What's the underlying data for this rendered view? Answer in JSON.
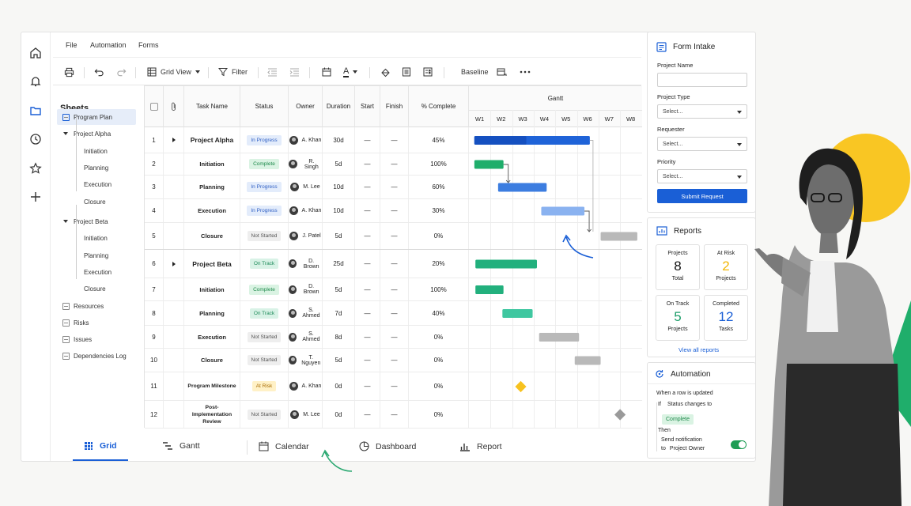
{
  "menu": [
    "File",
    "Automation",
    "Forms"
  ],
  "toolbar": {
    "grid_view": "Grid View",
    "filter": "Filter",
    "font_color_letter": "A",
    "baseline": "Baseline"
  },
  "sheets": {
    "title": "Sheets",
    "items": [
      {
        "label": "Program Plan",
        "level": 0,
        "active": true
      },
      {
        "label": "Project Alpha",
        "level": 1,
        "expanded": true
      },
      {
        "label": "Initiation",
        "level": 2
      },
      {
        "label": "Planning",
        "level": 2
      },
      {
        "label": "Execution",
        "level": 2
      },
      {
        "label": "Closure",
        "level": 2
      },
      {
        "label": "Project Beta",
        "level": 1,
        "expanded": true
      },
      {
        "label": "Initiation",
        "level": 2
      },
      {
        "label": "Planning",
        "level": 2
      },
      {
        "label": "Execution",
        "level": 2
      },
      {
        "label": "Closure",
        "level": 2
      },
      {
        "label": "Resources",
        "level": 0
      },
      {
        "label": "Risks",
        "level": 0
      },
      {
        "label": "Issues",
        "level": 0
      },
      {
        "label": "Dependencies Log",
        "level": 0
      }
    ]
  },
  "grid": {
    "columns": [
      "Task Name",
      "Status",
      "Owner",
      "Duration",
      "Start",
      "Finish",
      "% Complete"
    ],
    "gantt_title": "Gantt",
    "weeks": [
      "W1",
      "W2",
      "W3",
      "W4",
      "W5",
      "W6",
      "W7",
      "W8"
    ],
    "rows": [
      {
        "num": "1",
        "task": "Project Alpha",
        "parent": true,
        "status": "In Progress",
        "status_kind": "prog",
        "owner": "A. Khan",
        "duration": "30d",
        "start": "—",
        "finish": "—",
        "pct": "45%",
        "bar": {
          "start_week": 0.25,
          "end_week": 5.6,
          "kind": "parent-blue",
          "progress": 0.45
        }
      },
      {
        "num": "2",
        "task": "Initiation",
        "status": "Complete",
        "status_kind": "comp",
        "owner": "R. Singh",
        "duration": "5d",
        "start": "—",
        "finish": "—",
        "pct": "100%",
        "bar": {
          "start_week": 0.25,
          "end_week": 1.6,
          "kind": "green"
        }
      },
      {
        "num": "3",
        "task": "Planning",
        "status": "In Progress",
        "status_kind": "prog",
        "owner": "M. Lee",
        "duration": "10d",
        "start": "—",
        "finish": "—",
        "pct": "60%",
        "bar": {
          "start_week": 1.35,
          "end_week": 3.6,
          "kind": "blue"
        }
      },
      {
        "num": "4",
        "task": "Execution",
        "status": "In Progress",
        "status_kind": "prog",
        "owner": "A. Khan",
        "duration": "10d",
        "start": "—",
        "finish": "—",
        "pct": "30%",
        "bar": {
          "start_week": 3.35,
          "end_week": 5.35,
          "kind": "lightblue"
        }
      },
      {
        "num": "5",
        "task": "Closure",
        "status": "Not Started",
        "status_kind": "ns",
        "owner": "J. Patel",
        "duration": "5d",
        "start": "—",
        "finish": "—",
        "pct": "0%",
        "bar": {
          "start_week": 6.1,
          "end_week": 7.8,
          "kind": "gray"
        }
      },
      {
        "num": "6",
        "task": "Project Beta",
        "parent": true,
        "status": "On Track",
        "status_kind": "track",
        "owner": "D. Brown",
        "duration": "25d",
        "start": "—",
        "finish": "—",
        "pct": "20%",
        "bar": {
          "start_week": 0.3,
          "end_week": 3.15,
          "kind": "teal"
        }
      },
      {
        "num": "7",
        "task": "Initiation",
        "status": "Complete",
        "status_kind": "comp",
        "owner": "D. Brown",
        "duration": "5d",
        "start": "—",
        "finish": "—",
        "pct": "100%",
        "bar": {
          "start_week": 0.3,
          "end_week": 1.6,
          "kind": "teal"
        }
      },
      {
        "num": "8",
        "task": "Planning",
        "status": "On Track",
        "status_kind": "track",
        "owner": "S. Ahmed",
        "duration": "7d",
        "start": "—",
        "finish": "—",
        "pct": "40%",
        "bar": {
          "start_week": 1.55,
          "end_week": 2.95,
          "kind": "lightteal"
        }
      },
      {
        "num": "9",
        "task": "Execution",
        "status": "Not Started",
        "status_kind": "ns",
        "owner": "S. Ahmed",
        "duration": "8d",
        "start": "—",
        "finish": "—",
        "pct": "0%",
        "bar": {
          "start_week": 3.25,
          "end_week": 5.1,
          "kind": "gray"
        }
      },
      {
        "num": "10",
        "task": "Closure",
        "status": "Not Started",
        "status_kind": "ns",
        "owner": "T. Nguyen",
        "duration": "5d",
        "start": "—",
        "finish": "—",
        "pct": "0%",
        "bar": {
          "start_week": 4.9,
          "end_week": 6.1,
          "kind": "gray"
        }
      },
      {
        "num": "11",
        "task": "Program Milestone",
        "status": "At Risk",
        "status_kind": "risk",
        "owner": "A. Khan",
        "duration": "0d",
        "start": "—",
        "finish": "—",
        "pct": "0%",
        "bar": {
          "milestone_week": 2.4,
          "kind": "milestone-yellow"
        }
      },
      {
        "num": "12",
        "task": "Post-Implementation Review",
        "status": "Not Started",
        "status_kind": "ns",
        "owner": "M. Lee",
        "duration": "0d",
        "start": "—",
        "finish": "—",
        "pct": "0%",
        "bar": {
          "milestone_week": 7.0,
          "kind": "milestone-gray"
        }
      }
    ]
  },
  "bottom_tabs": [
    {
      "label": "Grid",
      "active": true
    },
    {
      "label": "Gantt"
    },
    {
      "label": "Calendar"
    },
    {
      "label": "Dashboard"
    },
    {
      "label": "Report"
    }
  ],
  "form": {
    "title": "Form Intake",
    "project_name_label": "Project Name",
    "project_type_label": "Project Type",
    "project_type_value": "Select...",
    "requester_label": "Requester",
    "requester_value": "Select...",
    "priority_label": "Priority",
    "priority_value": "Select...",
    "submit": "Submit Request"
  },
  "reports": {
    "title": "Reports",
    "cards": [
      {
        "label": "Projects",
        "value": "8",
        "sub": "Total",
        "color": "#111111"
      },
      {
        "label": "At Risk",
        "value": "2",
        "sub": "Projects",
        "color": "#f2b705"
      },
      {
        "label": "On Track",
        "value": "5",
        "sub": "Projects",
        "color": "#1e9e6a"
      },
      {
        "label": "Completed",
        "value": "12",
        "sub": "Tasks",
        "color": "#1a5fd6"
      }
    ],
    "link": "View all reports"
  },
  "automation": {
    "title": "Automation",
    "trigger": "When a row is updated",
    "if_label": "If",
    "condition": "Status changes to",
    "condition_value": "Complete",
    "then_label": "Then",
    "action": "Send notification",
    "to_label": "to",
    "target": "Project Owner",
    "toggle_on": true
  },
  "colors": {
    "accent": "#1a5fd6",
    "green": "#1fae6b",
    "yellow": "#f9c623"
  }
}
